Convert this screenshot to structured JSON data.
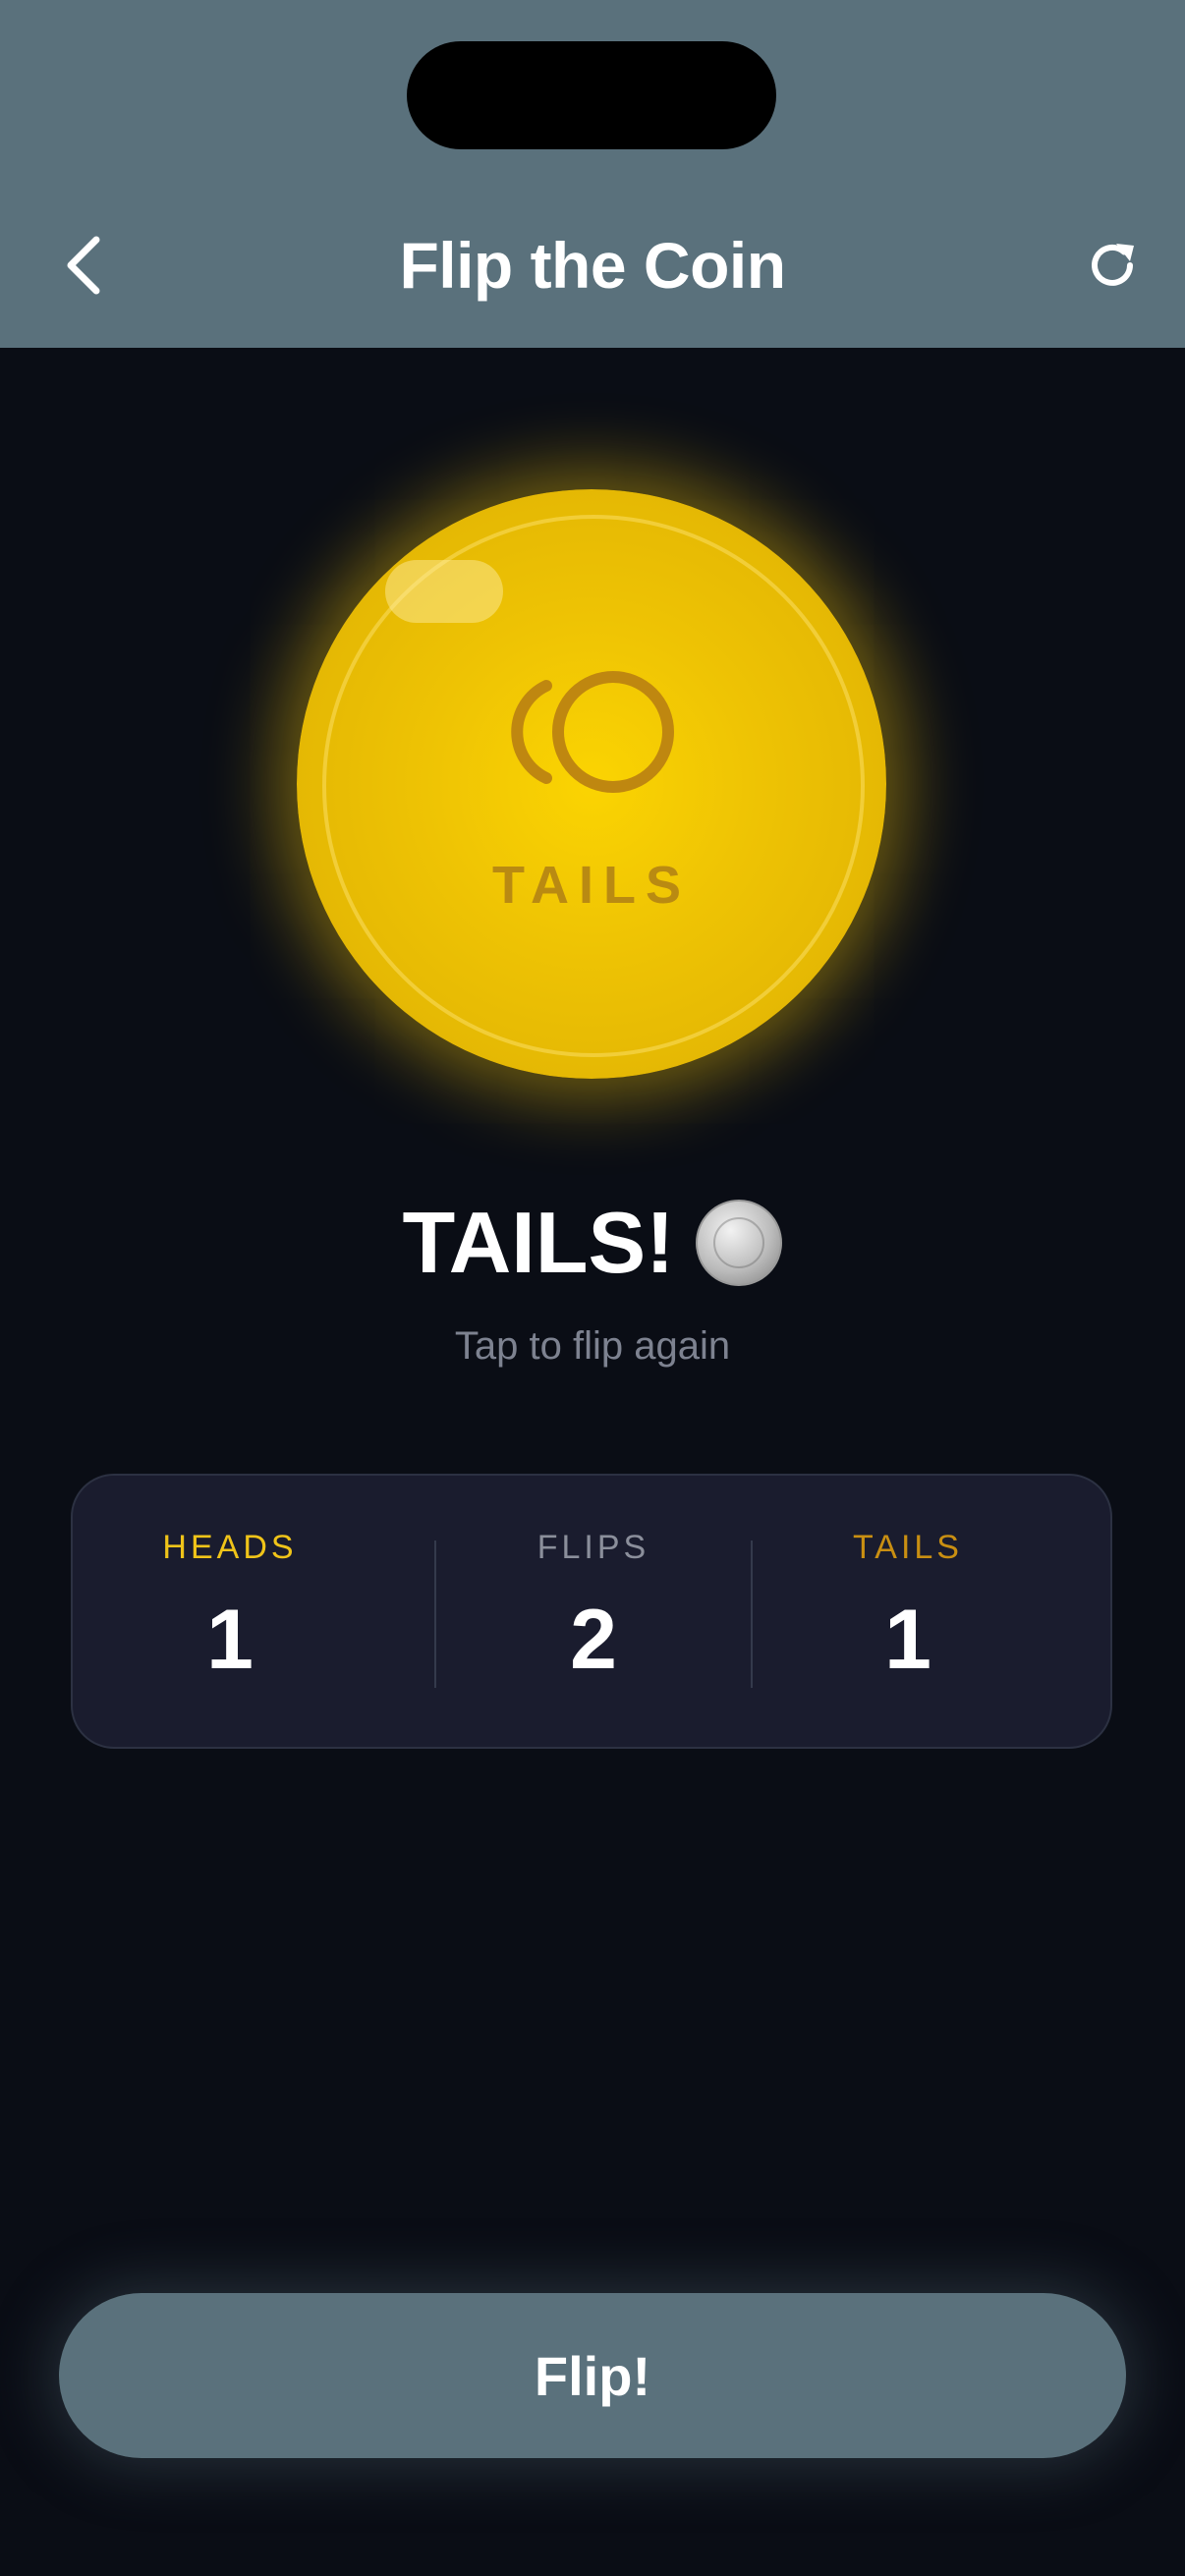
{
  "header": {
    "title": "Flip the Coin",
    "back_icon": "chevron-left-icon",
    "refresh_icon": "refresh-icon",
    "background": "#5a717c"
  },
  "coin": {
    "face_label": "TAILS",
    "glyph_icon": "tails-ring-icon",
    "color": "#f5c905"
  },
  "result": {
    "text": "TAILS!",
    "icon": "silver-coin-icon",
    "hint": "Tap to flip again"
  },
  "stats": {
    "heads": {
      "label": "HEADS",
      "value": "1",
      "color": "#f0c419"
    },
    "flips": {
      "label": "FLIPS",
      "value": "2",
      "color": "#8b8f9b"
    },
    "tails": {
      "label": "TAILS",
      "value": "1",
      "color": "#c98f12"
    }
  },
  "flip_button": {
    "label": "Flip!"
  }
}
